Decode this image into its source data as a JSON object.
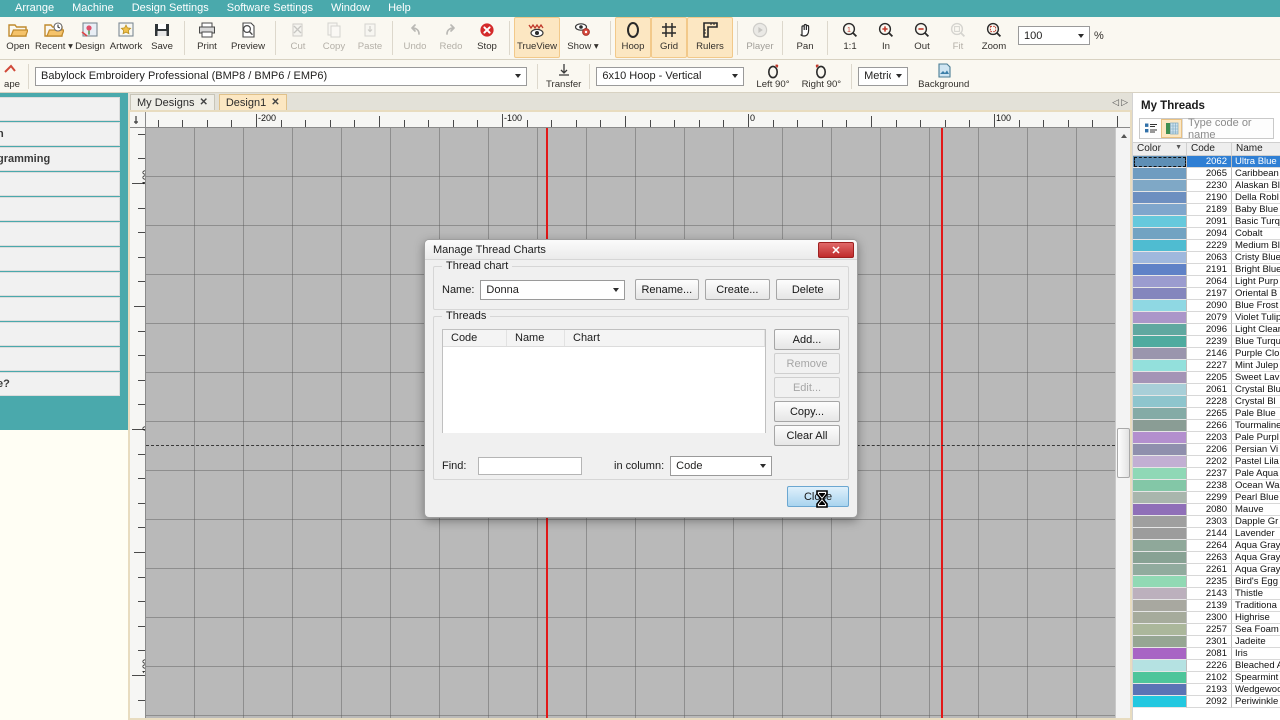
{
  "menubar": {
    "items": [
      "Arrange",
      "Machine",
      "Design Settings",
      "Software Settings",
      "Window",
      "Help"
    ]
  },
  "ribbon": {
    "groups": [
      {
        "buttons": [
          {
            "label": "Open",
            "icon": "folder-open-icon",
            "state": "normal"
          },
          {
            "label": "Recent",
            "icon": "folder-clock-icon",
            "state": "normal",
            "dropdown": true
          },
          {
            "label": "Design",
            "icon": "design-flower-icon",
            "state": "normal"
          },
          {
            "label": "Artwork",
            "icon": "artwork-star-icon",
            "state": "normal"
          },
          {
            "label": "Save",
            "icon": "floppy-save-icon",
            "state": "normal"
          }
        ]
      },
      {
        "buttons": [
          {
            "label": "Print",
            "icon": "printer-icon",
            "state": "normal"
          },
          {
            "label": "Preview",
            "icon": "print-preview-icon",
            "state": "normal"
          }
        ]
      },
      {
        "buttons": [
          {
            "label": "Cut",
            "icon": "scissors-icon",
            "state": "disabled"
          },
          {
            "label": "Copy",
            "icon": "copy-icon",
            "state": "disabled"
          },
          {
            "label": "Paste",
            "icon": "paste-icon",
            "state": "disabled"
          }
        ]
      },
      {
        "buttons": [
          {
            "label": "Undo",
            "icon": "undo-arrow-icon",
            "state": "disabled"
          },
          {
            "label": "Redo",
            "icon": "redo-arrow-icon",
            "state": "disabled"
          },
          {
            "label": "Stop",
            "icon": "stop-x-icon",
            "state": "normal"
          }
        ]
      },
      {
        "buttons": [
          {
            "label": "TrueView",
            "icon": "trueview-eye-icon",
            "state": "active"
          },
          {
            "label": "Show",
            "icon": "show-eye-gear-icon",
            "state": "normal",
            "dropdown": true
          }
        ]
      },
      {
        "buttons": [
          {
            "label": "Hoop",
            "icon": "hoop-icon",
            "state": "active"
          },
          {
            "label": "Grid",
            "icon": "grid-icon",
            "state": "active"
          },
          {
            "label": "Rulers",
            "icon": "rulers-icon",
            "state": "active"
          }
        ]
      },
      {
        "buttons": [
          {
            "label": "Player",
            "icon": "player-play-icon",
            "state": "disabled"
          }
        ]
      },
      {
        "buttons": [
          {
            "label": "Pan",
            "icon": "pan-hand-icon",
            "state": "normal"
          }
        ]
      },
      {
        "buttons": [
          {
            "label": "1:1",
            "icon": "zoom-one-to-one-icon",
            "state": "normal"
          },
          {
            "label": "In",
            "icon": "zoom-in-icon",
            "state": "normal"
          },
          {
            "label": "Out",
            "icon": "zoom-out-icon",
            "state": "normal"
          },
          {
            "label": "Fit",
            "icon": "zoom-fit-icon",
            "state": "disabled"
          },
          {
            "label": "Zoom",
            "icon": "zoom-marquee-icon",
            "state": "normal"
          }
        ]
      }
    ],
    "zoom_value": "100",
    "zoom_unit": "%"
  },
  "bar2": {
    "shape_label": "ape",
    "machine_value": "Babylock Embroidery Professional (BMP8 / BMP6 / EMP6)",
    "transfer_label": "Transfer",
    "hoop_value": "6x10 Hoop - Vertical",
    "left90_label": "Left 90°",
    "right90_label": "Right 90°",
    "units_value": "Metric",
    "background_label": "Background"
  },
  "left_panel": {
    "rows": [
      "",
      "n",
      "gramming",
      "",
      "",
      "",
      "",
      "",
      "",
      "",
      "",
      "e?"
    ]
  },
  "doc_tabs": {
    "tabs": [
      {
        "label": "My Designs",
        "selected": false,
        "close": "✕"
      },
      {
        "label": "Design1",
        "selected": true,
        "close": "✕"
      }
    ],
    "nav_prev": "◁",
    "nav_next": "▷"
  },
  "rulers": {
    "horizontal_labels": [
      "-200",
      "-100",
      "0",
      "100"
    ],
    "vertical_labels": [
      "100",
      "0",
      "-100"
    ]
  },
  "right_panel": {
    "title": "My Threads",
    "toolbar": {
      "list_view_icon": "list-view-icon",
      "grid_view_icon": "grid-view-icon",
      "search_placeholder": "Type code or name"
    },
    "columns": [
      "Color",
      "Code",
      "Name"
    ],
    "threads": [
      {
        "code": "2062",
        "name": "Ultra Blue",
        "color": "#5e8fb5",
        "selected": true
      },
      {
        "code": "2065",
        "name": "Caribbean",
        "color": "#6f9cc0",
        "selected": false
      },
      {
        "code": "2230",
        "name": "Alaskan Bl",
        "color": "#7fa8c6",
        "selected": false
      },
      {
        "code": "2190",
        "name": "Della Robl",
        "color": "#6d8fc0",
        "selected": false
      },
      {
        "code": "2189",
        "name": "Baby Blue",
        "color": "#7fa6cc",
        "selected": false
      },
      {
        "code": "2091",
        "name": "Basic Turq",
        "color": "#66c9dc",
        "selected": false
      },
      {
        "code": "2094",
        "name": "Cobalt",
        "color": "#72a3c2",
        "selected": false
      },
      {
        "code": "2229",
        "name": "Medium Bl",
        "color": "#4fbcd1",
        "selected": false
      },
      {
        "code": "2063",
        "name": "Cristy Blue",
        "color": "#9fb8dd",
        "selected": false
      },
      {
        "code": "2191",
        "name": "Bright Blue",
        "color": "#5f82c7",
        "selected": false
      },
      {
        "code": "2064",
        "name": "Light Purp",
        "color": "#9b9ccf",
        "selected": false
      },
      {
        "code": "2197",
        "name": "Oriental B",
        "color": "#8486bd",
        "selected": false
      },
      {
        "code": "2090",
        "name": "Blue Frost",
        "color": "#8fd8e3",
        "selected": false
      },
      {
        "code": "2079",
        "name": "Violet Tulip",
        "color": "#ab96c9",
        "selected": false
      },
      {
        "code": "2096",
        "name": "Light Clear",
        "color": "#60a8a0",
        "selected": false
      },
      {
        "code": "2239",
        "name": "Blue Turqu",
        "color": "#4fab9f",
        "selected": false
      },
      {
        "code": "2146",
        "name": "Purple Clo",
        "color": "#9a95ad",
        "selected": false
      },
      {
        "code": "2227",
        "name": "Mint Julep",
        "color": "#93e0dc",
        "selected": false
      },
      {
        "code": "2205",
        "name": "Sweet Lav",
        "color": "#a494b6",
        "selected": false
      },
      {
        "code": "2061",
        "name": "Crystal Blu",
        "color": "#a8cfd8",
        "selected": false
      },
      {
        "code": "2228",
        "name": "Crystal Bl",
        "color": "#8ec5cd",
        "selected": false
      },
      {
        "code": "2265",
        "name": "Pale Blue",
        "color": "#84aba6",
        "selected": false
      },
      {
        "code": "2266",
        "name": "Tourmaline",
        "color": "#8a9d95",
        "selected": false
      },
      {
        "code": "2203",
        "name": "Pale Purpl",
        "color": "#b38fce",
        "selected": false
      },
      {
        "code": "2206",
        "name": "Persian Vi",
        "color": "#8f8fad",
        "selected": false
      },
      {
        "code": "2202",
        "name": "Pastel Lila",
        "color": "#c2afd3",
        "selected": false
      },
      {
        "code": "2237",
        "name": "Pale Aqua",
        "color": "#8fd8b6",
        "selected": false
      },
      {
        "code": "2238",
        "name": "Ocean Wa",
        "color": "#83c7a7",
        "selected": false
      },
      {
        "code": "2299",
        "name": "Pearl Blue",
        "color": "#a9b6ad",
        "selected": false
      },
      {
        "code": "2080",
        "name": "Mauve",
        "color": "#8f6fb8",
        "selected": false
      },
      {
        "code": "2303",
        "name": "Dapple Gr",
        "color": "#9f9f9f",
        "selected": false
      },
      {
        "code": "2144",
        "name": "Lavender",
        "color": "#9c9c9c",
        "selected": false
      },
      {
        "code": "2264",
        "name": "Aqua Gray",
        "color": "#8fa89a",
        "selected": false
      },
      {
        "code": "2263",
        "name": "Aqua Gray",
        "color": "#88a294",
        "selected": false
      },
      {
        "code": "2261",
        "name": "Aqua Gray",
        "color": "#91ab9e",
        "selected": false
      },
      {
        "code": "2235",
        "name": "Bird's Egg",
        "color": "#91d9b4",
        "selected": false
      },
      {
        "code": "2143",
        "name": "Thistle",
        "color": "#bcb0bd",
        "selected": false
      },
      {
        "code": "2139",
        "name": "Traditiona",
        "color": "#a8a8a0",
        "selected": false
      },
      {
        "code": "2300",
        "name": "Highrise",
        "color": "#a6ab9c",
        "selected": false
      },
      {
        "code": "2257",
        "name": "Sea Foam",
        "color": "#abb79b",
        "selected": false
      },
      {
        "code": "2301",
        "name": "Jadeite",
        "color": "#96a693",
        "selected": false
      },
      {
        "code": "2081",
        "name": "Iris",
        "color": "#a864c4",
        "selected": false
      },
      {
        "code": "2226",
        "name": "Bleached A",
        "color": "#b5e2e2",
        "selected": false
      },
      {
        "code": "2102",
        "name": "Spearmint",
        "color": "#4ec59a",
        "selected": false
      },
      {
        "code": "2193",
        "name": "Wedgewoo",
        "color": "#5b73b5",
        "selected": false
      },
      {
        "code": "2092",
        "name": "Periwinkle",
        "color": "#23c8e0",
        "selected": false
      }
    ]
  },
  "dialog": {
    "title": "Manage Thread Charts",
    "close_glyph": "✕",
    "thread_chart": {
      "group_label": "Thread chart",
      "name_label": "Name:",
      "name_value": "Donna",
      "rename_label": "Rename...",
      "create_label": "Create...",
      "delete_label": "Delete"
    },
    "threads": {
      "group_label": "Threads",
      "columns": [
        "Code",
        "Name",
        "Chart"
      ],
      "rows": [],
      "buttons": [
        {
          "label": "Add...",
          "state": "normal"
        },
        {
          "label": "Remove",
          "state": "disabled"
        },
        {
          "label": "Edit...",
          "state": "disabled"
        },
        {
          "label": "Copy...",
          "state": "normal"
        },
        {
          "label": "Clear All",
          "state": "normal"
        }
      ]
    },
    "find": {
      "label": "Find:",
      "value": "",
      "in_column_label": "in column:",
      "in_column_value": "Code"
    },
    "close_button": "Close"
  },
  "colors": {
    "menubar_bg": "#4aa9ac",
    "ribbon_bg": "#faf8f1",
    "active_tool": "#fce7c2",
    "hoop_line": "#e21818",
    "selection_blue": "#2f7fd4",
    "canvas_bg": "#b9b9b9"
  }
}
